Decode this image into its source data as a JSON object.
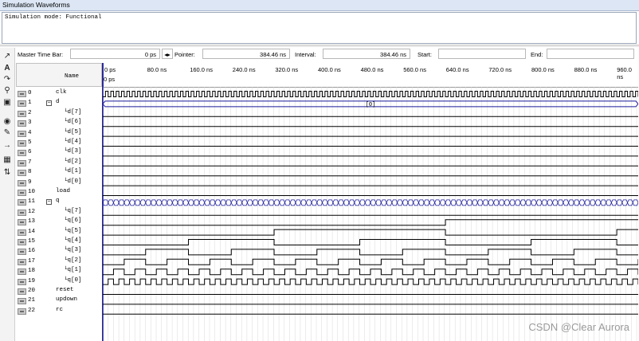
{
  "window": {
    "title": "Simulation Waveforms",
    "mode_text": "Simulation mode: Functional"
  },
  "toolbar": {
    "master_time_bar_label": "Master Time Bar:",
    "master_time_bar_value": "0 ps",
    "pointer_label": "Pointer:",
    "pointer_value": "384.46 ns",
    "interval_label": "Interval:",
    "interval_value": "384.46 ns",
    "start_label": "Start:",
    "start_value": "",
    "end_label": "End:",
    "end_value": ""
  },
  "tools": [
    "select-icon",
    "text-icon",
    "waveform-edit-icon",
    "zoom-icon",
    "fullscreen-icon",
    "find-icon",
    "replace-icon",
    "arrow-right-icon",
    "group-icon",
    "sort-icon"
  ],
  "header": {
    "name_col": "Name",
    "ruler_zero": "0 ps"
  },
  "ruler_ticks": [
    "0 ps",
    "80.0 ns",
    "160.0 ns",
    "240.0 ns",
    "320.0 ns",
    "400.0 ns",
    "480.0 ns",
    "560.0 ns",
    "640.0 ns",
    "720.0 ns",
    "800.0 ns",
    "880.0 ns",
    "960.0 ns"
  ],
  "signals": [
    {
      "index": "0",
      "name": "clk",
      "kind": "in"
    },
    {
      "index": "1",
      "name": "d",
      "kind": "in",
      "group": true,
      "value": "[0]"
    },
    {
      "index": "2",
      "name": "d[7]",
      "kind": "in",
      "child": true
    },
    {
      "index": "3",
      "name": "d[6]",
      "kind": "in",
      "child": true
    },
    {
      "index": "4",
      "name": "d[5]",
      "kind": "in",
      "child": true
    },
    {
      "index": "5",
      "name": "d[4]",
      "kind": "in",
      "child": true
    },
    {
      "index": "6",
      "name": "d[3]",
      "kind": "in",
      "child": true
    },
    {
      "index": "7",
      "name": "d[2]",
      "kind": "in",
      "child": true
    },
    {
      "index": "8",
      "name": "d[1]",
      "kind": "in",
      "child": true
    },
    {
      "index": "9",
      "name": "d[0]",
      "kind": "in",
      "child": true
    },
    {
      "index": "10",
      "name": "load",
      "kind": "in"
    },
    {
      "index": "11",
      "name": "q",
      "kind": "out",
      "group": true
    },
    {
      "index": "12",
      "name": "q[7]",
      "kind": "out",
      "child": true
    },
    {
      "index": "13",
      "name": "q[6]",
      "kind": "out",
      "child": true
    },
    {
      "index": "14",
      "name": "q[5]",
      "kind": "out",
      "child": true
    },
    {
      "index": "15",
      "name": "q[4]",
      "kind": "out",
      "child": true
    },
    {
      "index": "16",
      "name": "q[3]",
      "kind": "out",
      "child": true
    },
    {
      "index": "17",
      "name": "q[2]",
      "kind": "out",
      "child": true
    },
    {
      "index": "18",
      "name": "q[1]",
      "kind": "out",
      "child": true
    },
    {
      "index": "19",
      "name": "q[0]",
      "kind": "out",
      "child": true
    },
    {
      "index": "20",
      "name": "reset",
      "kind": "out"
    },
    {
      "index": "21",
      "name": "updown",
      "kind": "out"
    },
    {
      "index": "22",
      "name": "rc",
      "kind": "out"
    }
  ],
  "watermark": "CSDN @Clear Aurora",
  "colors": {
    "wave": "#000000",
    "bus": "#1a1a9a",
    "accent": "#2a2a9a"
  }
}
